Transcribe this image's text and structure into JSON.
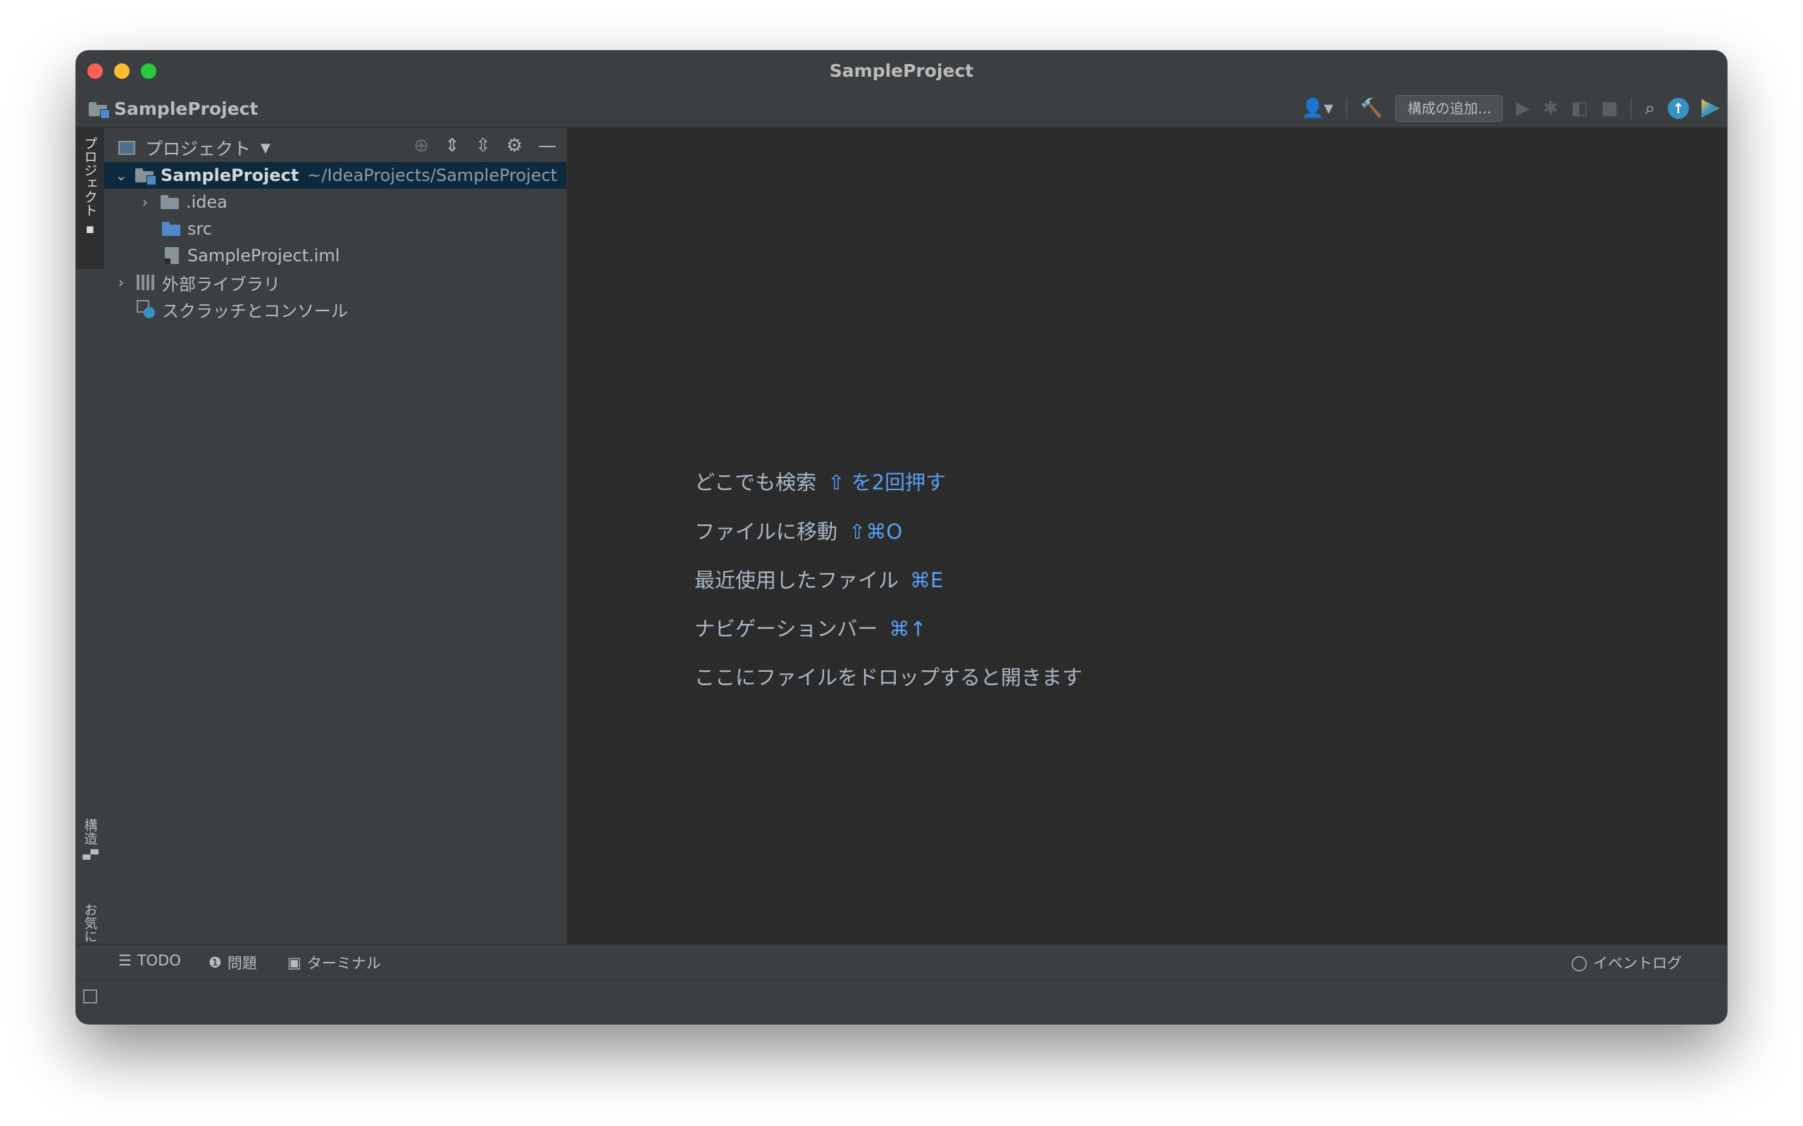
{
  "window": {
    "title": "SampleProject"
  },
  "navbar": {
    "project": "SampleProject",
    "config_button": "構成の追加..."
  },
  "left_strip": {
    "project_tab": "プロジェクト",
    "structure_tab": "構造",
    "favorites_tab": "お気に入り"
  },
  "project_panel": {
    "title": "プロジェクト",
    "tree": [
      {
        "label": "SampleProject",
        "path": "~/IdeaProjects/SampleProject",
        "expanded": true
      },
      {
        "label": ".idea"
      },
      {
        "label": "src"
      },
      {
        "label": "SampleProject.iml"
      },
      {
        "label": "外部ライブラリ"
      },
      {
        "label": "スクラッチとコンソール"
      }
    ]
  },
  "editor": {
    "hints": [
      {
        "text": "どこでも検索",
        "key": "⇧ を2回押す"
      },
      {
        "text": "ファイルに移動",
        "key": "⇧⌘O"
      },
      {
        "text": "最近使用したファイル",
        "key": "⌘E"
      },
      {
        "text": "ナビゲーションバー",
        "key": "⌘↑"
      },
      {
        "text": "ここにファイルをドロップすると開きます",
        "key": ""
      }
    ]
  },
  "bottom_tools": {
    "todo": "TODO",
    "problems": "問題",
    "terminal": "ターミナル",
    "event_log": "イベントログ"
  },
  "colors": {
    "accent_blue": "#589df6",
    "selection": "#0d293e",
    "panel_bg": "#3c3f41",
    "editor_bg": "#2b2b2b"
  }
}
